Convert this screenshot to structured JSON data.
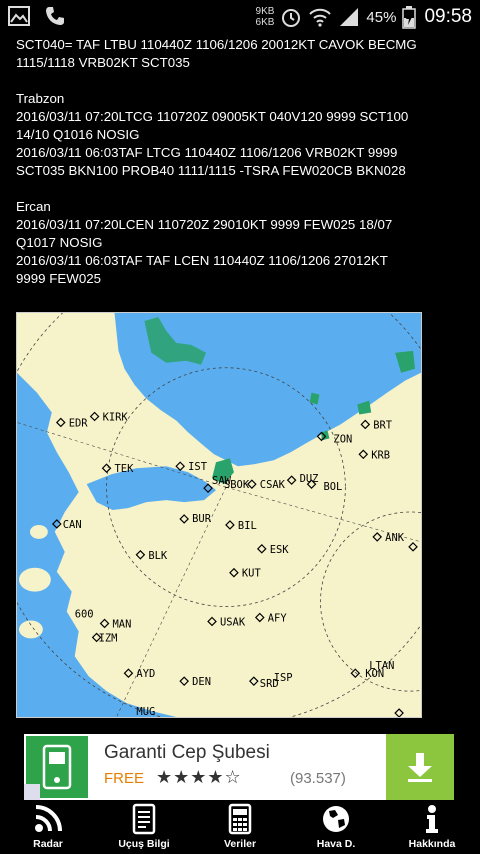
{
  "status": {
    "net_up": "9KB",
    "net_down": "6KB",
    "battery": "45%",
    "time": "09:58"
  },
  "continuation": "SCT040= TAF LTBU 110440Z 1106/1206 20012KT CAVOK BECMG\n1115/1118 VRB02KT SCT035",
  "stations": [
    {
      "name": "Trabzon",
      "reports": [
        "2016/03/11 07:20LTCG 110720Z 09005KT 040V120 9999 SCT100\n14/10 Q1016 NOSIG",
        "2016/03/11 06:03TAF LTCG 110440Z 1106/1206 VRB02KT 9999\nSCT035 BKN100 PROB40 1111/1115 -TSRA FEW020CB BKN028"
      ]
    },
    {
      "name": "Ercan",
      "reports": [
        "2016/03/11 07:20LCEN 110720Z 29010KT 9999 FEW025 18/07\nQ1017 NOSIG",
        "2016/03/11 06:03TAF TAF LCEN 110440Z 1106/1206 27012KT\n9999 FEW025"
      ]
    }
  ],
  "map": {
    "land_color": "#f6f2c9",
    "sea_color": "#5aaef0",
    "labels": [
      "EDR",
      "KIRK",
      "TEK",
      "IST",
      "SAW",
      "SBOK",
      "CSAK",
      "DUZ",
      "BOL",
      "ZON",
      "BRT",
      "KRB",
      "CAN",
      "BUR",
      "BIL",
      "ESK",
      "ANK",
      "BLK",
      "KUT",
      "600",
      "MAN",
      "IZM",
      "USAK",
      "AFY",
      "AYD",
      "DEN",
      "SRD",
      "ISP",
      "LTAN",
      "KON",
      "MUG"
    ]
  },
  "ad": {
    "title": "Garanti Cep Şubesi",
    "price": "FREE",
    "stars": "★★★★☆",
    "reviews": "(93.537)"
  },
  "nav": [
    {
      "label": "Radar"
    },
    {
      "label": "Uçuş Bilgi"
    },
    {
      "label": "Veriler"
    },
    {
      "label": "Hava D."
    },
    {
      "label": "Hakkında"
    }
  ]
}
